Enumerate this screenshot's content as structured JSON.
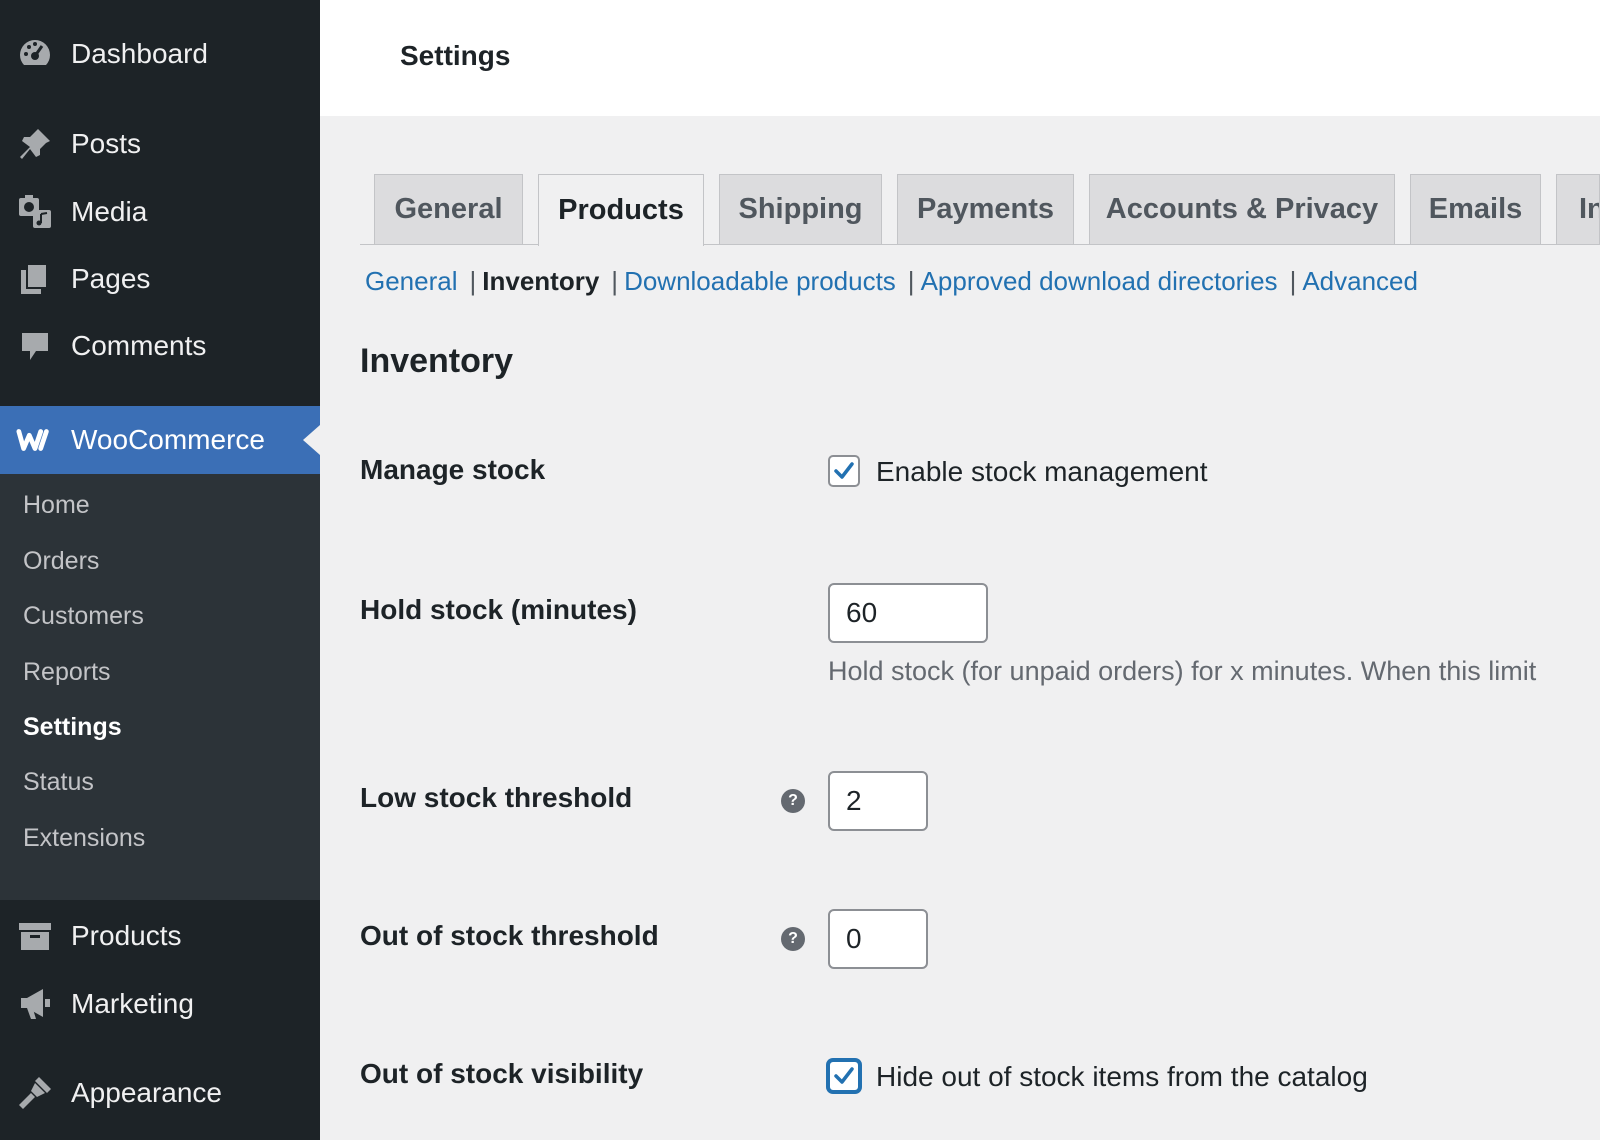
{
  "sidebar": {
    "top_items": [
      {
        "label": "Dashboard",
        "icon": "dashboard-icon"
      },
      {
        "label": "Posts",
        "icon": "pin-icon"
      },
      {
        "label": "Media",
        "icon": "media-icon"
      },
      {
        "label": "Pages",
        "icon": "pages-icon"
      },
      {
        "label": "Comments",
        "icon": "comment-icon"
      }
    ],
    "woocommerce": {
      "label": "WooCommerce",
      "icon": "woocommerce-icon"
    },
    "submenu": [
      "Home",
      "Orders",
      "Customers",
      "Reports",
      "Settings",
      "Status",
      "Extensions"
    ],
    "submenu_current": "Settings",
    "bottom_items": [
      {
        "label": "Products",
        "icon": "archive-icon"
      },
      {
        "label": "Marketing",
        "icon": "megaphone-icon"
      },
      {
        "label": "Appearance",
        "icon": "paintbrush-icon"
      }
    ]
  },
  "header": {
    "title": "Settings"
  },
  "tabs": [
    "General",
    "Products",
    "Shipping",
    "Payments",
    "Accounts & Privacy",
    "Emails",
    "Int"
  ],
  "active_tab": "Products",
  "subnav": {
    "items": [
      "General",
      "Inventory",
      "Downloadable products",
      "Approved download directories",
      "Advanced"
    ],
    "current": "Inventory",
    "separator": "|"
  },
  "section": {
    "title": "Inventory"
  },
  "fields": {
    "manage_stock": {
      "label": "Manage stock",
      "checkbox_label": "Enable stock management",
      "checked": true
    },
    "hold_stock": {
      "label": "Hold stock (minutes)",
      "value": "60",
      "description": "Hold stock (for unpaid orders) for x minutes. When this limit"
    },
    "low_stock": {
      "label": "Low stock threshold",
      "value": "2",
      "help_icon": "?"
    },
    "out_of_stock": {
      "label": "Out of stock threshold",
      "value": "0",
      "help_icon": "?"
    },
    "visibility": {
      "label": "Out of stock visibility",
      "checkbox_label": "Hide out of stock items from the catalog",
      "checked": true
    }
  },
  "colors": {
    "sidebar_bg": "#1d2327",
    "submenu_bg": "#2c3338",
    "accent": "#3b6fb6",
    "link": "#2271b1",
    "page_bg": "#f0f0f1"
  }
}
